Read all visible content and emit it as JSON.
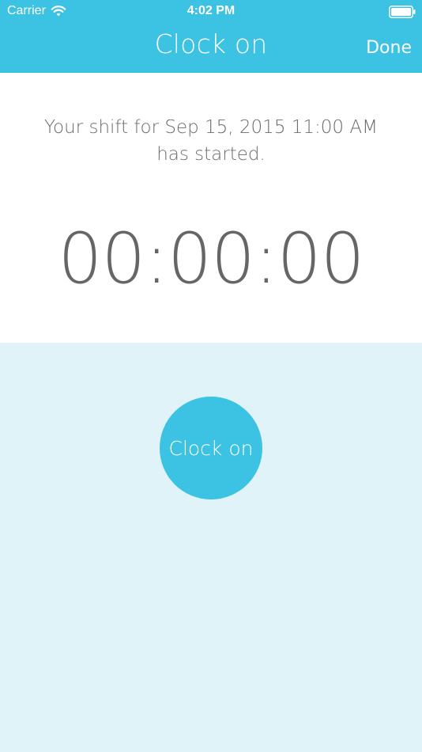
{
  "status_bar": {
    "carrier": "Carrier",
    "time": "4:02 PM",
    "wifi_icon": "wifi-icon",
    "battery_icon": "battery-icon"
  },
  "nav": {
    "title": "Clock on",
    "done_label": "Done"
  },
  "shift": {
    "message": "Your shift for Sep 15, 2015 11:00 AM has started.",
    "timer": "00:00:00"
  },
  "action": {
    "clock_on_label": "Clock on"
  },
  "colors": {
    "accent": "#3cc2e2",
    "panel_background": "#ffffff",
    "action_background": "#e0f3f8",
    "text_gray": "#6c6c6c"
  }
}
